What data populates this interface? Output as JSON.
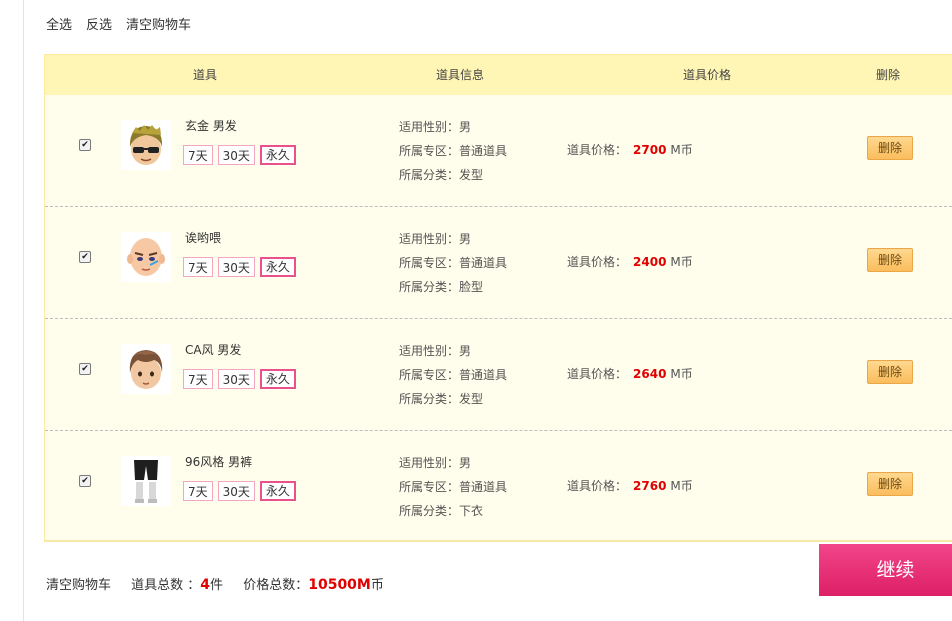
{
  "toolbar": {
    "select_all": "全选",
    "invert": "反选",
    "clear": "清空购物车"
  },
  "columns": {
    "item": "道具",
    "info": "道具信息",
    "price": "道具价格",
    "delete": "删除"
  },
  "items": [
    {
      "name": "玄金 男发",
      "durations": [
        "7天",
        "30天",
        "永久"
      ],
      "selected_duration": "永久",
      "gender": "适用性别：男",
      "zone": "所属专区：普通道具",
      "category": "所属分类：发型",
      "price_label": "道具价格：",
      "price": "2700",
      "currency": "M币",
      "delete_label": "删除",
      "checked": true,
      "icon": "hair-icon"
    },
    {
      "name": "诶哟喂",
      "durations": [
        "7天",
        "30天",
        "永久"
      ],
      "selected_duration": "永久",
      "gender": "适用性别：男",
      "zone": "所属专区：普通道具",
      "category": "所属分类：脸型",
      "price_label": "道具价格：",
      "price": "2400",
      "currency": "M币",
      "delete_label": "删除",
      "checked": true,
      "icon": "face-icon"
    },
    {
      "name": "CA风 男发",
      "durations": [
        "7天",
        "30天",
        "永久"
      ],
      "selected_duration": "永久",
      "gender": "适用性别：男",
      "zone": "所属专区：普通道具",
      "category": "所属分类：发型",
      "price_label": "道具价格：",
      "price": "2640",
      "currency": "M币",
      "delete_label": "删除",
      "checked": true,
      "icon": "hair-icon"
    },
    {
      "name": "96风格 男裤",
      "durations": [
        "7天",
        "30天",
        "永久"
      ],
      "selected_duration": "永久",
      "gender": "适用性别：男",
      "zone": "所属专区：普通道具",
      "category": "所属分类：下衣",
      "price_label": "道具价格：",
      "price": "2760",
      "currency": "M币",
      "delete_label": "删除",
      "checked": true,
      "icon": "pants-icon"
    }
  ],
  "footer": {
    "clear": "清空购物车",
    "count_label": "道具总数 ：",
    "count": "4",
    "count_unit": "件",
    "total_label": "价格总数：",
    "total": "10500M",
    "total_unit": "币"
  },
  "continue_label": "继续",
  "colors": {
    "accent": "#e8518c",
    "price_red": "#e00000",
    "header_bg": "#fff5b4",
    "row_bg": "#fffdeb"
  }
}
